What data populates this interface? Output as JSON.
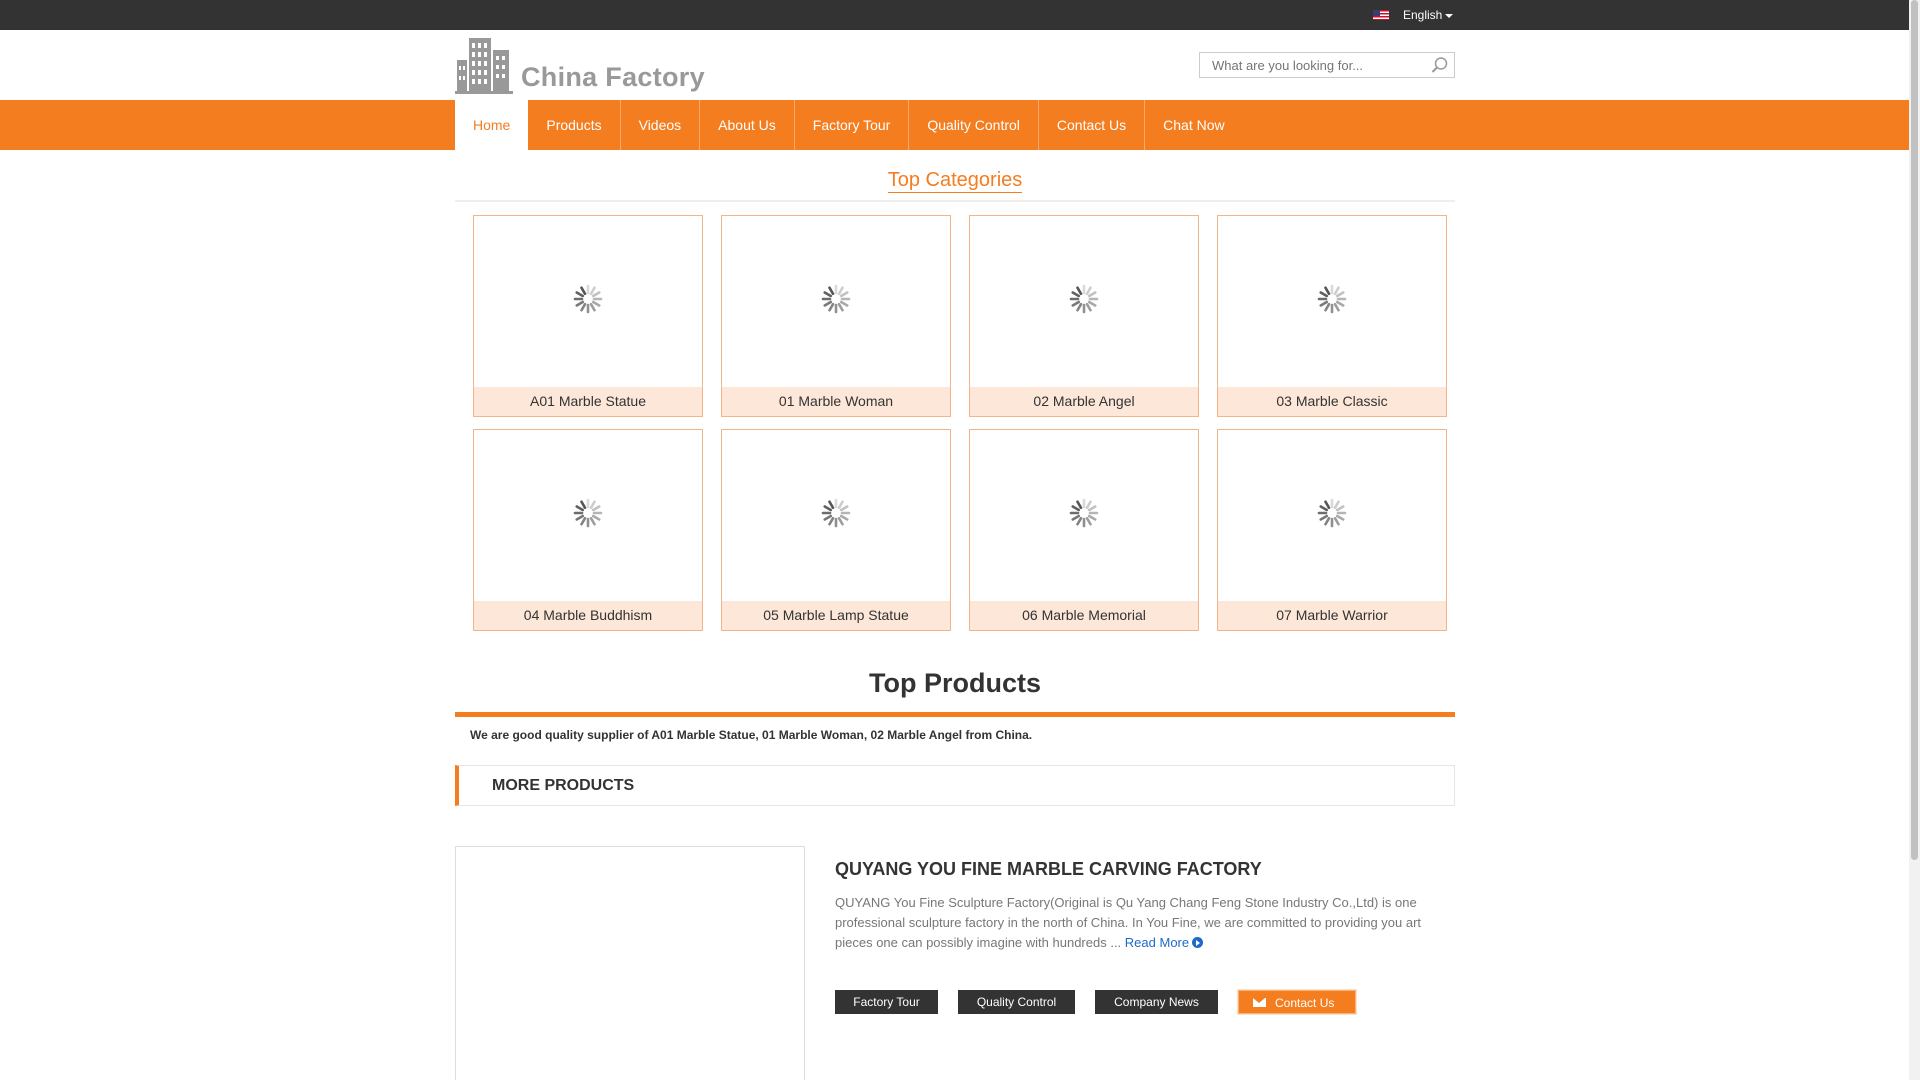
{
  "topbar": {
    "language": "English",
    "flag_icon": "us-flag-icon"
  },
  "header": {
    "logo_text": "China Factory",
    "search": {
      "placeholder": "What are you looking for..."
    }
  },
  "nav": {
    "items": [
      {
        "label": "Home",
        "active": true
      },
      {
        "label": "Products"
      },
      {
        "label": "Videos"
      },
      {
        "label": "About Us"
      },
      {
        "label": "Factory Tour"
      },
      {
        "label": "Quality Control"
      },
      {
        "label": "Contact Us"
      },
      {
        "label": "Chat Now"
      }
    ]
  },
  "top_categories": {
    "title": "Top Categories",
    "items": [
      {
        "label": "A01 Marble Statue"
      },
      {
        "label": "01 Marble Woman"
      },
      {
        "label": "02 Marble Angel"
      },
      {
        "label": "03 Marble Classic"
      },
      {
        "label": "04 Marble Buddhism"
      },
      {
        "label": "05 Marble Lamp Statue"
      },
      {
        "label": "06 Marble Memorial"
      },
      {
        "label": "07 Marble Warrior"
      }
    ]
  },
  "top_products": {
    "title": "Top Products",
    "description": "We are good quality supplier of A01 Marble Statue, 01 Marble Woman, 02 Marble Angel from China.",
    "more_label": "MORE PRODUCTS"
  },
  "company": {
    "name": "QUYANG YOU FINE MARBLE CARVING FACTORY",
    "description": "QUYANG You Fine Sculpture Factory(Original is Qu Yang Chang Feng Stone Industry Co.,Ltd) is one professional sculpture factory in the north of China. In You Fine, we are committed to providing you art pieces one can possibly imagine with hundreds ...",
    "read_more": "Read More",
    "buttons": {
      "factory_tour": "Factory Tour",
      "quality_control": "Quality Control",
      "company_news": "Company News",
      "contact_us": "Contact Us"
    }
  },
  "colors": {
    "accent": "#f47d20",
    "topbar": "#333333",
    "link": "#1d6ac9"
  }
}
